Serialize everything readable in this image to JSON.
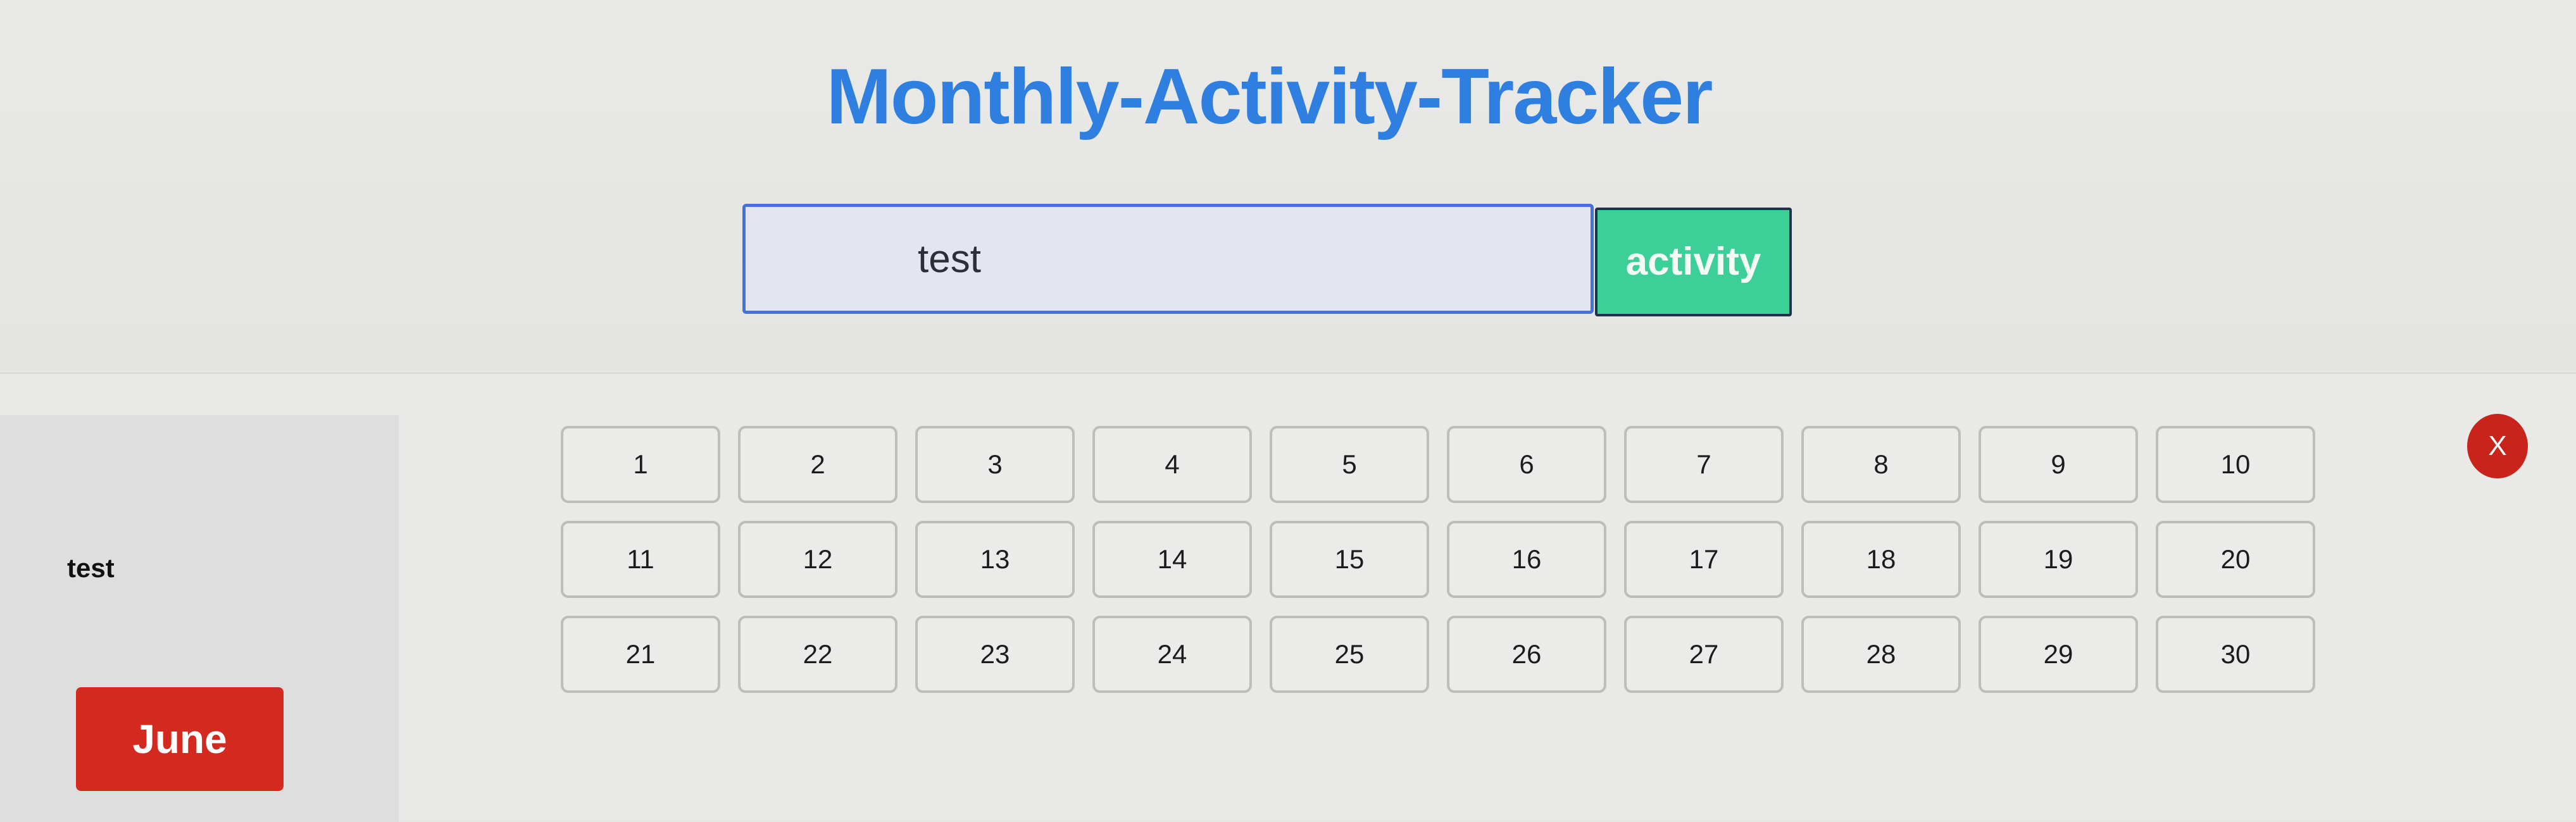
{
  "header": {
    "title": "Monthly-Activity-Tracker",
    "input_value": "test",
    "add_button_label": "activity"
  },
  "tracker": {
    "activity_name": "test",
    "month_label": "June",
    "close_label": "X",
    "days": [
      "1",
      "2",
      "3",
      "4",
      "5",
      "6",
      "7",
      "8",
      "9",
      "10",
      "11",
      "12",
      "13",
      "14",
      "15",
      "16",
      "17",
      "18",
      "19",
      "20",
      "21",
      "22",
      "23",
      "24",
      "25",
      "26",
      "27",
      "28",
      "29",
      "30"
    ]
  },
  "colors": {
    "title": "#2f7fe0",
    "input_border": "#4472d8",
    "add_button": "#3ccf97",
    "month_button": "#d3291f",
    "close_button": "#c8241b"
  }
}
